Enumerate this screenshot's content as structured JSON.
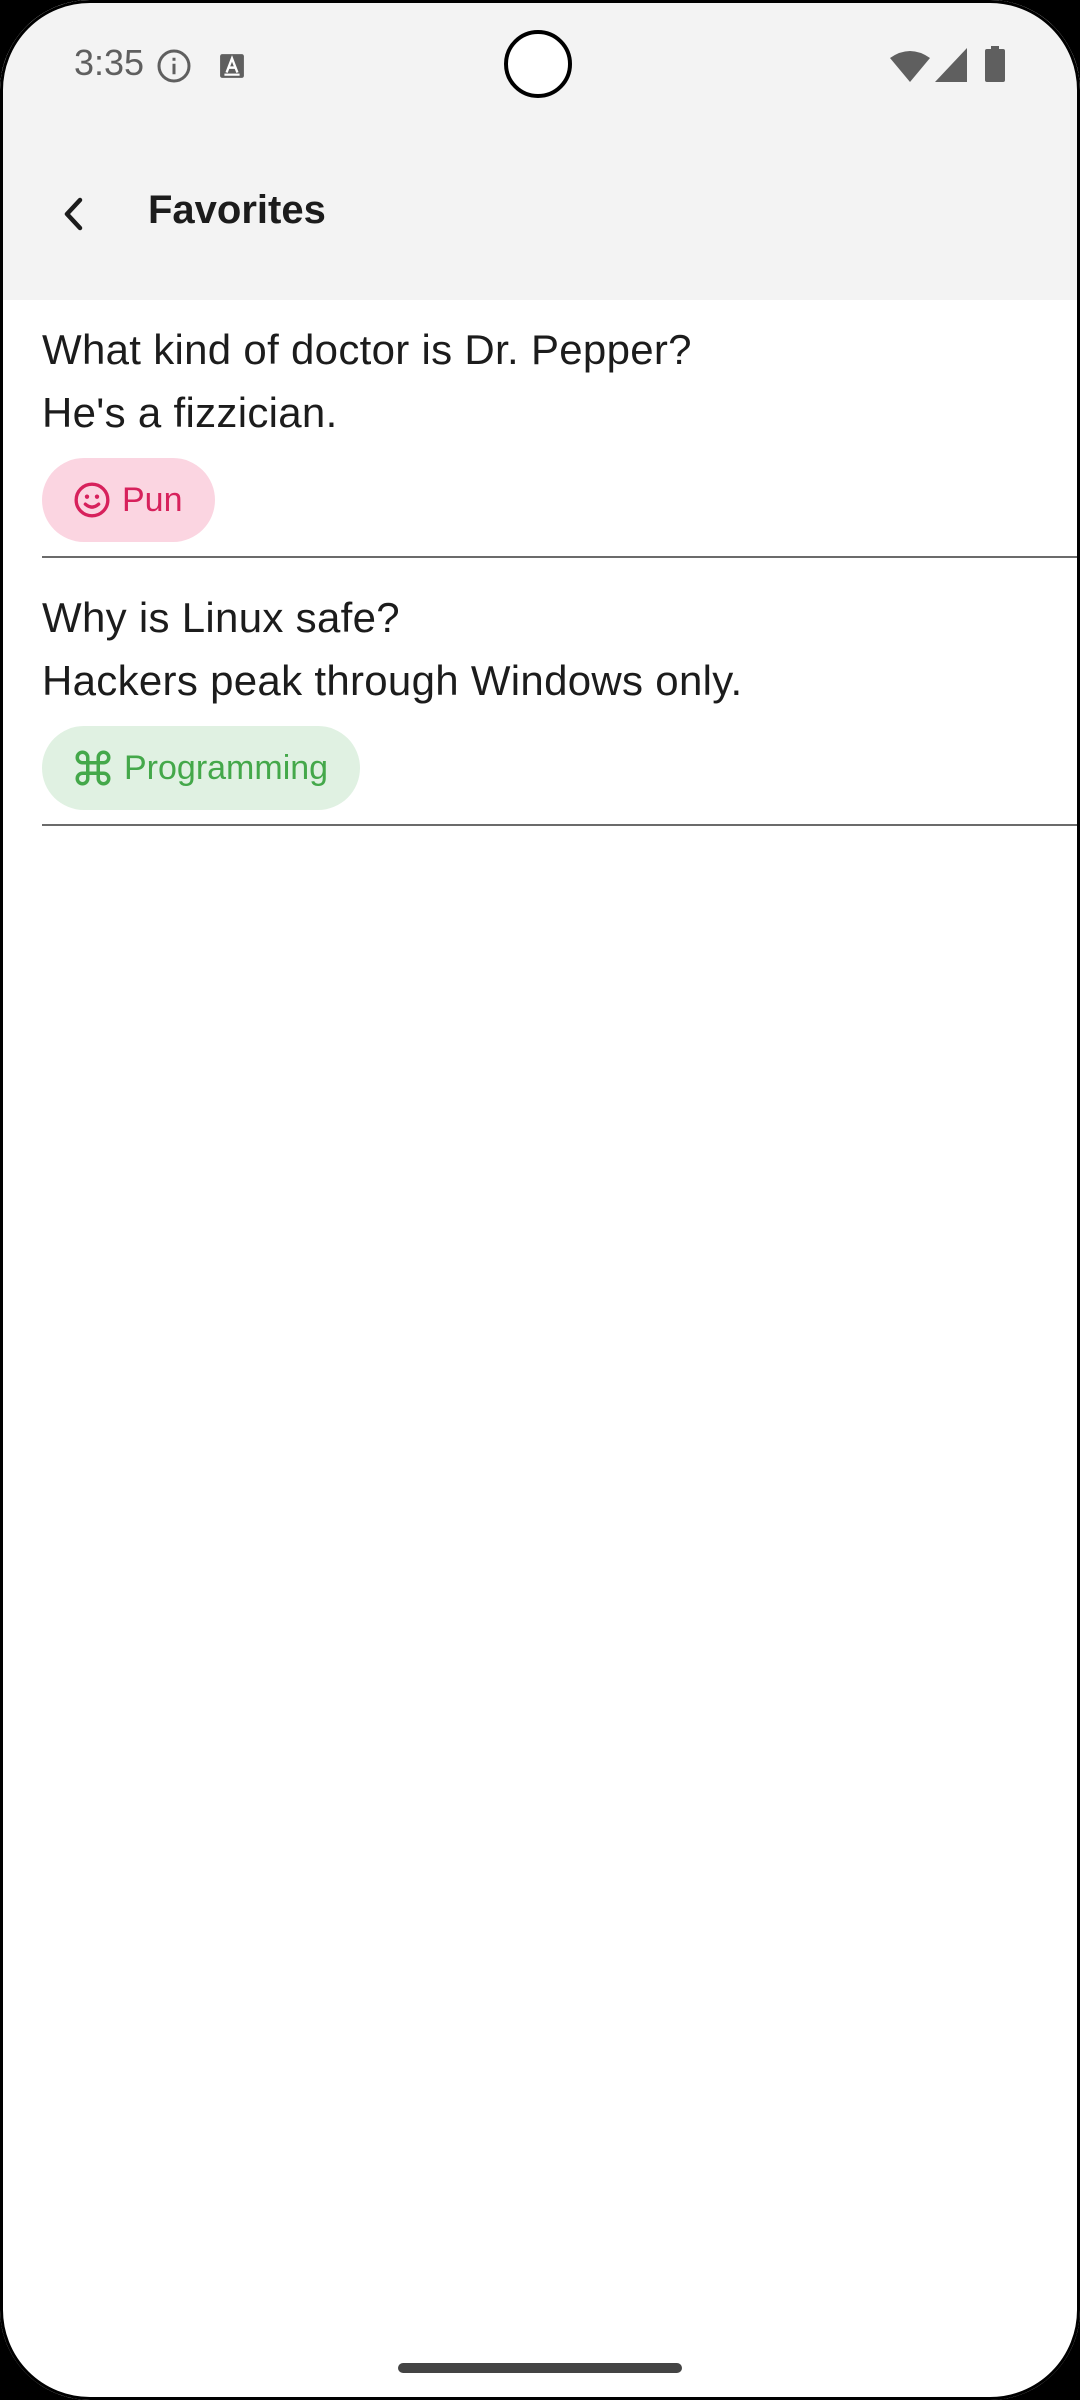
{
  "status_bar": {
    "time": "3:35",
    "icons": [
      "info-icon",
      "a-icon",
      "wifi-icon",
      "cellular-icon",
      "battery-icon"
    ]
  },
  "app_bar": {
    "back_icon": "chevron-left-icon",
    "title": "Favorites"
  },
  "jokes": [
    {
      "setup": "What kind of doctor is Dr. Pepper?",
      "punchline": "He's a fizzician.",
      "category": "Pun",
      "category_icon": "smiley-icon",
      "chip_color": "#d7215c",
      "chip_bg": "#fbd5e1"
    },
    {
      "setup": "Why is Linux safe?",
      "punchline": "Hackers peak through Windows only.",
      "category": "Programming",
      "category_icon": "command-icon",
      "chip_color": "#44a84a",
      "chip_bg": "#e0f1e2"
    }
  ]
}
